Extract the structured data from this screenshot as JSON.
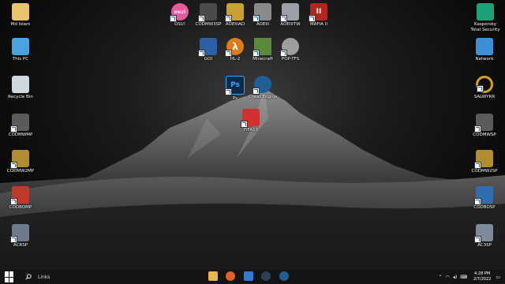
{
  "desktop_icons": [
    {
      "label": "Md Islam",
      "icon": "user-folder-icon",
      "color": "#e9c46a"
    },
    {
      "label": "This PC",
      "icon": "computer-icon",
      "color": "#4aa3df"
    },
    {
      "label": "Recycle Bin",
      "icon": "recycle-bin-icon",
      "color": "#cfd8dc"
    },
    {
      "label": "CODMWMP",
      "icon": "cod-mw-icon",
      "color": "#5b5b5b"
    },
    {
      "label": "CODMW2MP",
      "icon": "cod-mw2-icon",
      "color": "#b08d2e"
    },
    {
      "label": "CODBOMP",
      "icon": "cod-bo-icon",
      "color": "#c0392b"
    },
    {
      "label": "ACRSP",
      "icon": "ac-rogue-icon",
      "color": "#6d7b8d"
    },
    {
      "label": "OSU!",
      "icon": "osu-icon",
      "color": "#e85a9e",
      "glyph": "osu!"
    },
    {
      "label": "CODMW3SP",
      "icon": "cod-mw3-icon",
      "color": "#4b4b4b"
    },
    {
      "label": "AOEIIIAD",
      "icon": "aoe3-icon",
      "color": "#c8a032"
    },
    {
      "label": "AOEIII",
      "icon": "aoe3-helmet-icon",
      "color": "#8a8a8a"
    },
    {
      "label": "AOEIIITW",
      "icon": "aoe3-tw-icon",
      "color": "#9aa0a6"
    },
    {
      "label": "MAFIA II",
      "icon": "mafia-icon",
      "color": "#b3261e",
      "glyph": "II"
    },
    {
      "label": "GOI",
      "icon": "goi-icon",
      "color": "#2b5fa6"
    },
    {
      "label": "HL-2",
      "icon": "half-life-icon",
      "color": "#e07b1a",
      "glyph": "λ"
    },
    {
      "label": "Minecraft",
      "icon": "minecraft-icon",
      "color": "#5a8a3a"
    },
    {
      "label": "POP-TFS",
      "icon": "pop-icon",
      "color": "#9e9e9e"
    },
    {
      "label": "Ps",
      "icon": "photoshop-icon",
      "color": "#0b2a4a",
      "glyph": "Ps"
    },
    {
      "label": "Cheat Engine",
      "icon": "cheat-engine-icon",
      "color": "#1d5f96"
    },
    {
      "label": "FIFA13",
      "icon": "fifa-icon",
      "color": "#d32f2f"
    },
    {
      "label": "Kaspersky\nTotal Security",
      "icon": "kaspersky-icon",
      "color": "#1fa07a"
    },
    {
      "label": "Network",
      "icon": "network-icon",
      "color": "#3f8ed8"
    },
    {
      "label": "SALWYRR",
      "icon": "salwyrr-icon",
      "color": "#d4a017"
    },
    {
      "label": "CODMWSP",
      "icon": "cod-mw-sp-icon",
      "color": "#5b5b5b"
    },
    {
      "label": "CODMW2SP",
      "icon": "cod-mw2-sp-icon",
      "color": "#b08d2e"
    },
    {
      "label": "CODBOSP",
      "icon": "cod-bo-sp-icon",
      "color": "#2f6fb0"
    },
    {
      "label": "AC3SP",
      "icon": "ac3-icon",
      "color": "#7d8a99"
    }
  ],
  "taskbar": {
    "search_text": "Links",
    "apps": [
      {
        "icon": "file-explorer-icon",
        "color": "#e8b64c"
      },
      {
        "icon": "firefox-icon",
        "color": "#e0622a"
      },
      {
        "icon": "calendar-app-icon",
        "color": "#2f7bd8"
      },
      {
        "icon": "steam-icon",
        "color": "#2a3f5a"
      },
      {
        "icon": "cheat-engine-task-icon",
        "color": "#1d5f96"
      }
    ]
  },
  "tray": {
    "time": "4:28 PM",
    "date": "2/7/2022"
  }
}
